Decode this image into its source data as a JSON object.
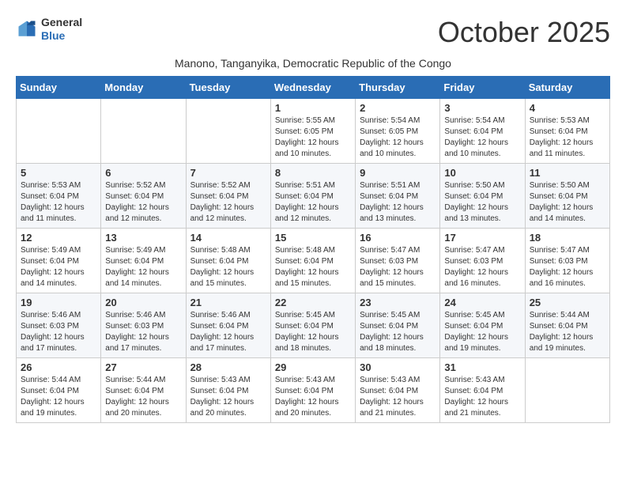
{
  "logo": {
    "line1": "General",
    "line2": "Blue"
  },
  "title": "October 2025",
  "subtitle": "Manono, Tanganyika, Democratic Republic of the Congo",
  "days_of_week": [
    "Sunday",
    "Monday",
    "Tuesday",
    "Wednesday",
    "Thursday",
    "Friday",
    "Saturday"
  ],
  "weeks": [
    [
      {
        "day": "",
        "info": ""
      },
      {
        "day": "",
        "info": ""
      },
      {
        "day": "",
        "info": ""
      },
      {
        "day": "1",
        "info": "Sunrise: 5:55 AM\nSunset: 6:05 PM\nDaylight: 12 hours\nand 10 minutes."
      },
      {
        "day": "2",
        "info": "Sunrise: 5:54 AM\nSunset: 6:05 PM\nDaylight: 12 hours\nand 10 minutes."
      },
      {
        "day": "3",
        "info": "Sunrise: 5:54 AM\nSunset: 6:04 PM\nDaylight: 12 hours\nand 10 minutes."
      },
      {
        "day": "4",
        "info": "Sunrise: 5:53 AM\nSunset: 6:04 PM\nDaylight: 12 hours\nand 11 minutes."
      }
    ],
    [
      {
        "day": "5",
        "info": "Sunrise: 5:53 AM\nSunset: 6:04 PM\nDaylight: 12 hours\nand 11 minutes."
      },
      {
        "day": "6",
        "info": "Sunrise: 5:52 AM\nSunset: 6:04 PM\nDaylight: 12 hours\nand 12 minutes."
      },
      {
        "day": "7",
        "info": "Sunrise: 5:52 AM\nSunset: 6:04 PM\nDaylight: 12 hours\nand 12 minutes."
      },
      {
        "day": "8",
        "info": "Sunrise: 5:51 AM\nSunset: 6:04 PM\nDaylight: 12 hours\nand 12 minutes."
      },
      {
        "day": "9",
        "info": "Sunrise: 5:51 AM\nSunset: 6:04 PM\nDaylight: 12 hours\nand 13 minutes."
      },
      {
        "day": "10",
        "info": "Sunrise: 5:50 AM\nSunset: 6:04 PM\nDaylight: 12 hours\nand 13 minutes."
      },
      {
        "day": "11",
        "info": "Sunrise: 5:50 AM\nSunset: 6:04 PM\nDaylight: 12 hours\nand 14 minutes."
      }
    ],
    [
      {
        "day": "12",
        "info": "Sunrise: 5:49 AM\nSunset: 6:04 PM\nDaylight: 12 hours\nand 14 minutes."
      },
      {
        "day": "13",
        "info": "Sunrise: 5:49 AM\nSunset: 6:04 PM\nDaylight: 12 hours\nand 14 minutes."
      },
      {
        "day": "14",
        "info": "Sunrise: 5:48 AM\nSunset: 6:04 PM\nDaylight: 12 hours\nand 15 minutes."
      },
      {
        "day": "15",
        "info": "Sunrise: 5:48 AM\nSunset: 6:04 PM\nDaylight: 12 hours\nand 15 minutes."
      },
      {
        "day": "16",
        "info": "Sunrise: 5:47 AM\nSunset: 6:03 PM\nDaylight: 12 hours\nand 15 minutes."
      },
      {
        "day": "17",
        "info": "Sunrise: 5:47 AM\nSunset: 6:03 PM\nDaylight: 12 hours\nand 16 minutes."
      },
      {
        "day": "18",
        "info": "Sunrise: 5:47 AM\nSunset: 6:03 PM\nDaylight: 12 hours\nand 16 minutes."
      }
    ],
    [
      {
        "day": "19",
        "info": "Sunrise: 5:46 AM\nSunset: 6:03 PM\nDaylight: 12 hours\nand 17 minutes."
      },
      {
        "day": "20",
        "info": "Sunrise: 5:46 AM\nSunset: 6:03 PM\nDaylight: 12 hours\nand 17 minutes."
      },
      {
        "day": "21",
        "info": "Sunrise: 5:46 AM\nSunset: 6:04 PM\nDaylight: 12 hours\nand 17 minutes."
      },
      {
        "day": "22",
        "info": "Sunrise: 5:45 AM\nSunset: 6:04 PM\nDaylight: 12 hours\nand 18 minutes."
      },
      {
        "day": "23",
        "info": "Sunrise: 5:45 AM\nSunset: 6:04 PM\nDaylight: 12 hours\nand 18 minutes."
      },
      {
        "day": "24",
        "info": "Sunrise: 5:45 AM\nSunset: 6:04 PM\nDaylight: 12 hours\nand 19 minutes."
      },
      {
        "day": "25",
        "info": "Sunrise: 5:44 AM\nSunset: 6:04 PM\nDaylight: 12 hours\nand 19 minutes."
      }
    ],
    [
      {
        "day": "26",
        "info": "Sunrise: 5:44 AM\nSunset: 6:04 PM\nDaylight: 12 hours\nand 19 minutes."
      },
      {
        "day": "27",
        "info": "Sunrise: 5:44 AM\nSunset: 6:04 PM\nDaylight: 12 hours\nand 20 minutes."
      },
      {
        "day": "28",
        "info": "Sunrise: 5:43 AM\nSunset: 6:04 PM\nDaylight: 12 hours\nand 20 minutes."
      },
      {
        "day": "29",
        "info": "Sunrise: 5:43 AM\nSunset: 6:04 PM\nDaylight: 12 hours\nand 20 minutes."
      },
      {
        "day": "30",
        "info": "Sunrise: 5:43 AM\nSunset: 6:04 PM\nDaylight: 12 hours\nand 21 minutes."
      },
      {
        "day": "31",
        "info": "Sunrise: 5:43 AM\nSunset: 6:04 PM\nDaylight: 12 hours\nand 21 minutes."
      },
      {
        "day": "",
        "info": ""
      }
    ]
  ]
}
